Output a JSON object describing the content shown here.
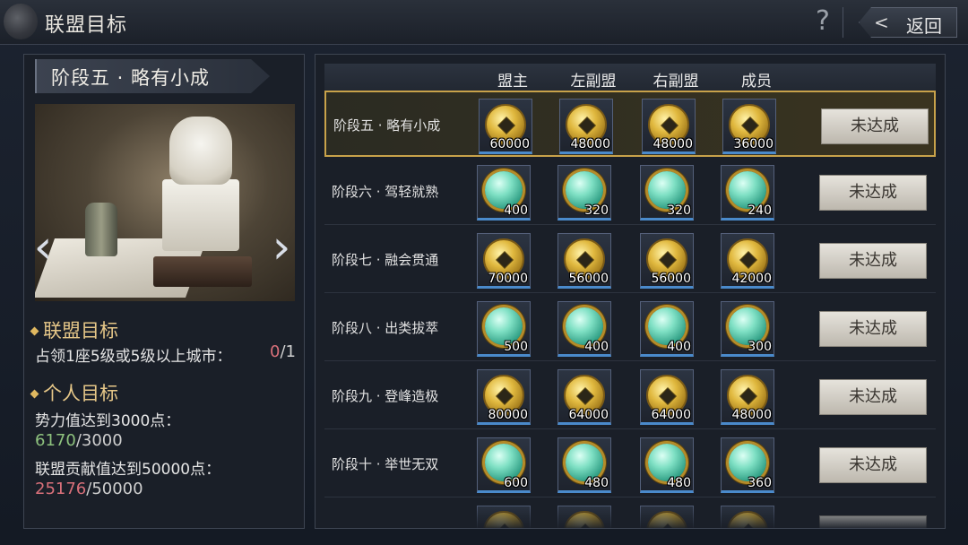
{
  "header": {
    "title": "联盟目标",
    "help_label": "?",
    "back_label": "返回",
    "back_chevron": "<"
  },
  "left": {
    "stage_title": "阶段五 · 略有小成",
    "image_icon": "jade-seal-image",
    "alliance_goal": {
      "heading": "联盟目标",
      "text": "占领1座5级或5级以上城市：",
      "current": "0",
      "total": "/1"
    },
    "personal_goal": {
      "heading": "个人目标",
      "items": [
        {
          "text": "势力值达到3000点：",
          "current": "6170",
          "total": "/3000"
        },
        {
          "text": "联盟贡献值达到50000点：",
          "current": "25176",
          "total": "/50000"
        }
      ]
    }
  },
  "table": {
    "columns": [
      "盟主",
      "左副盟",
      "右副盟",
      "成员"
    ],
    "rows": [
      {
        "label": "阶段五 · 略有小成",
        "reward_icon": "coin-icon",
        "amounts": [
          "60000",
          "48000",
          "48000",
          "36000"
        ],
        "status": "未达成",
        "active": true
      },
      {
        "label": "阶段六 · 驾轻就熟",
        "reward_icon": "jade-icon",
        "amounts": [
          "400",
          "320",
          "320",
          "240"
        ],
        "status": "未达成",
        "active": false
      },
      {
        "label": "阶段七 · 融会贯通",
        "reward_icon": "coin-icon",
        "amounts": [
          "70000",
          "56000",
          "56000",
          "42000"
        ],
        "status": "未达成",
        "active": false
      },
      {
        "label": "阶段八 · 出类拔萃",
        "reward_icon": "jade-icon",
        "amounts": [
          "500",
          "400",
          "400",
          "300"
        ],
        "status": "未达成",
        "active": false
      },
      {
        "label": "阶段九 · 登峰造极",
        "reward_icon": "coin-icon",
        "amounts": [
          "80000",
          "64000",
          "64000",
          "48000"
        ],
        "status": "未达成",
        "active": false
      },
      {
        "label": "阶段十 · 举世无双",
        "reward_icon": "jade-icon",
        "amounts": [
          "600",
          "480",
          "480",
          "360"
        ],
        "status": "未达成",
        "active": false
      },
      {
        "label": "",
        "reward_icon": "coin-icon",
        "amounts": [
          "",
          "",
          "",
          ""
        ],
        "status": "",
        "active": false
      }
    ]
  },
  "colors": {
    "accent_gold": "#c8a24a",
    "progress_red": "#d9707a",
    "progress_green": "#8ec27e"
  }
}
